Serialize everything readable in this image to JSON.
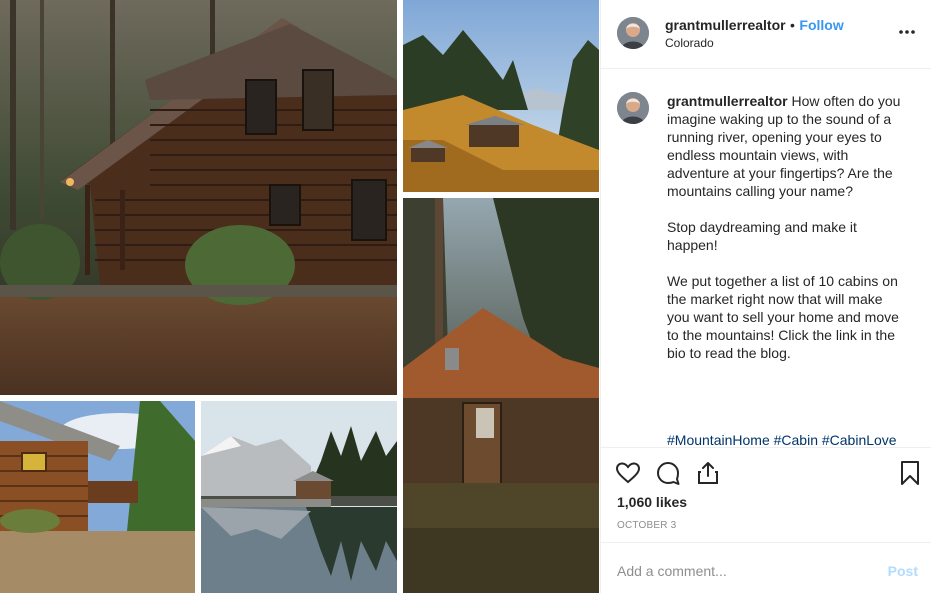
{
  "post": {
    "username": "grantmullerrealtor",
    "separator": "•",
    "follow_label": "Follow",
    "location": "Colorado",
    "caption_text": "How often do you imagine waking up to the sound of a running river, opening your eyes to endless mountain views, with adventure at your fingertips? Are the mountains calling your name?\n\nStop daydreaming and make it happen!\n\nWe put together a list of 10 cabins on the market right now that will make you want to sell your home and move to the mountains! Click the link in the bio to read the blog.",
    "hashtags": "#MountainHome #Cabin #CabinLove",
    "likes": "1,060 likes",
    "date": "OCTOBER 3",
    "comment_placeholder": "Add a comment...",
    "post_button": "Post"
  },
  "icons": {
    "more": "more-options-icon",
    "like": "heart-icon",
    "comment": "comment-icon",
    "share": "share-icon",
    "save": "bookmark-icon"
  },
  "colors": {
    "link": "#3897f0",
    "hashtag": "#003569",
    "muted": "#8e8e8e",
    "post_disabled": "#b3dbff"
  }
}
